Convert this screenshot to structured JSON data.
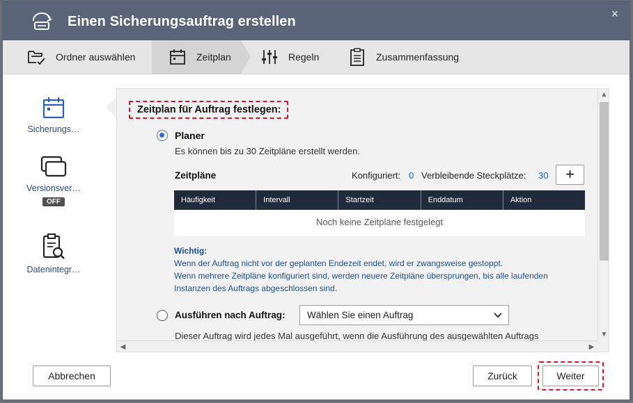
{
  "window": {
    "title": "Einen Sicherungsauftrag erstellen",
    "close": "×"
  },
  "steps": [
    {
      "label": "Ordner auswählen",
      "icon": "folder-check-icon"
    },
    {
      "label": "Zeitplan",
      "icon": "calendar-icon",
      "active": true
    },
    {
      "label": "Regeln",
      "icon": "sliders-icon"
    },
    {
      "label": "Zusammenfassung",
      "icon": "clipboard-icon"
    }
  ],
  "sidebar": {
    "items": [
      {
        "label": "Sicherungs…",
        "icon": "calendar-icon",
        "active": true
      },
      {
        "label": "Versionsver…",
        "icon": "versions-icon",
        "badge": "OFF"
      },
      {
        "label": "Datenintegr…",
        "icon": "clipboard-search-icon"
      }
    ]
  },
  "main": {
    "section_title": "Zeitplan für Auftrag festlegen:",
    "planer": {
      "label": "Planer",
      "selected": true,
      "description": "Es können bis zu 30 Zeitpläne erstellt werden."
    },
    "schedules": {
      "heading": "Zeitpläne",
      "configured_label": "Konfiguriert:",
      "configured_value": "0",
      "remaining_label": "Verbleibende Steckplätze:",
      "remaining_value": "30",
      "add_label": "+",
      "columns": [
        "Häufigkeit",
        "Intervall",
        "Startzeit",
        "Enddatum",
        "Aktion"
      ],
      "empty_text": "Noch keine Zeitpläne festgelegt"
    },
    "important": {
      "heading": "Wichtig:",
      "line1": "Wenn der Auftrag nicht vor der geplanten Endezeit endet, wird er zwangsweise gestoppt.",
      "line2": "Wenn mehrere Zeitpläne konfiguriert sind, werden neuere Zeitpläne übersprungen, bis alle laufenden",
      "line3": "Instanzen des Auftrags abgeschlossen sind."
    },
    "after_job": {
      "label": "Ausführen nach Auftrag:",
      "selected": false,
      "dropdown_value": "Wählen Sie einen Auftrag",
      "description": "Dieser Auftrag wird jedes Mal ausgeführt, wenn die Ausführung des ausgewählten Auftrags"
    }
  },
  "footer": {
    "cancel": "Abbrechen",
    "back": "Zurück",
    "next": "Weiter"
  },
  "colors": {
    "titlebar": "#5a6478",
    "accent_blue": "#1a5ec9",
    "highlight_red": "#e0112b",
    "table_header": "#1f2b3b"
  }
}
